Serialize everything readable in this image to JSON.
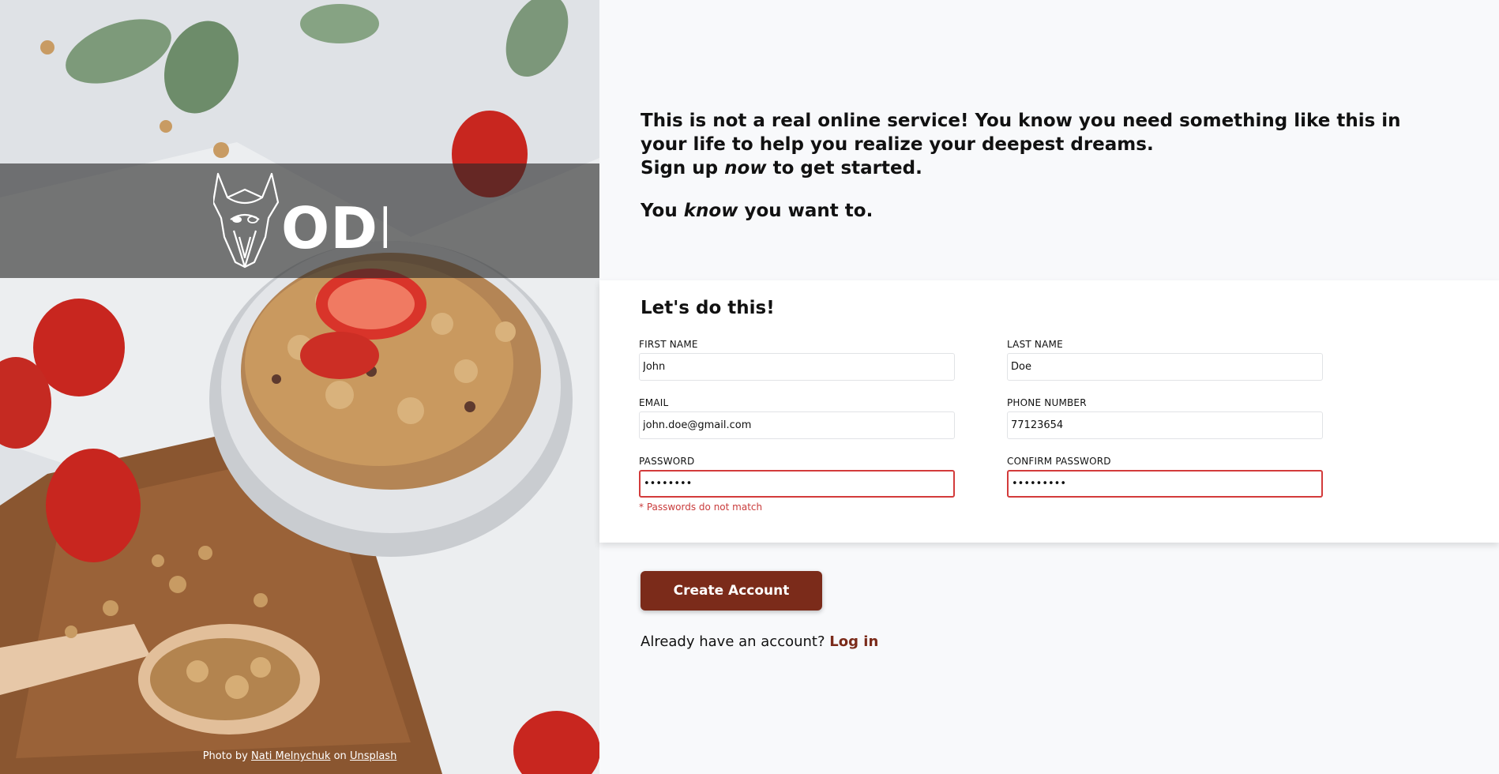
{
  "logo": {
    "text": "ODIN"
  },
  "credit": {
    "prefix": "Photo by",
    "author": "Nati Melnychuk",
    "middle": "on",
    "site": "Unsplash"
  },
  "intro": {
    "line1": "This is not a real online service! You know you need something like this in your life to help you realize your deepest dreams.",
    "line2_before": "Sign up",
    "line2_em": "now",
    "line2_after": "to get started.",
    "line3_before": "You",
    "line3_em": "know",
    "line3_after": "you want to."
  },
  "form": {
    "title": "Let's do this!",
    "fields": {
      "first_name": {
        "label": "FIRST NAME",
        "value": "John"
      },
      "last_name": {
        "label": "LAST NAME",
        "value": "Doe"
      },
      "email": {
        "label": "EMAIL",
        "value": "john.doe@gmail.com"
      },
      "phone": {
        "label": "PHONE NUMBER",
        "value": "77123654"
      },
      "password": {
        "label": "PASSWORD",
        "value": "password"
      },
      "confirm_password": {
        "label": "CONFIRM PASSWORD",
        "value": "password1"
      }
    },
    "error": "* Passwords do not match"
  },
  "actions": {
    "create_label": "Create Account",
    "login_prompt": "Already have an account?",
    "login_link": "Log in"
  },
  "colors": {
    "accent": "#7b2b1a",
    "error": "#c93c3c",
    "page_bg": "#f8f9fb"
  }
}
